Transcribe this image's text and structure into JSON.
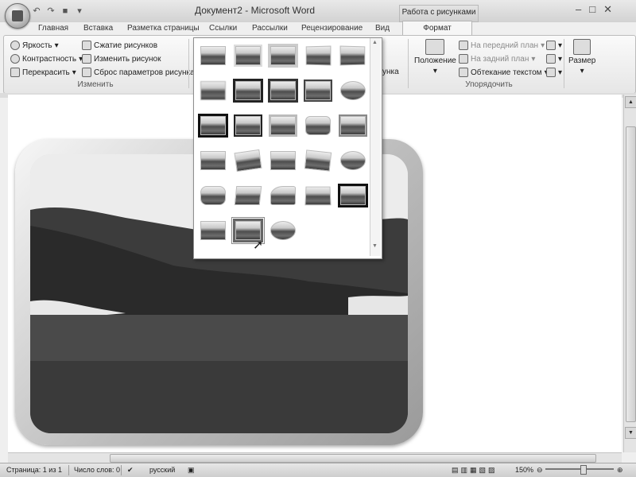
{
  "window": {
    "title": "Документ2 - Microsoft Word",
    "context_tab_group": "Работа с рисунками"
  },
  "quick_access": {
    "icons": [
      "save-icon",
      "undo-icon",
      "redo-icon",
      "customize-icon"
    ]
  },
  "tabs": [
    {
      "label": "Главная"
    },
    {
      "label": "Вставка"
    },
    {
      "label": "Разметка страницы"
    },
    {
      "label": "Ссылки"
    },
    {
      "label": "Рассылки"
    },
    {
      "label": "Рецензирование"
    },
    {
      "label": "Вид"
    },
    {
      "label": "Формат"
    }
  ],
  "ribbon": {
    "adjust": {
      "brightness": "Яркость",
      "contrast": "Контрастность",
      "recolor": "Перекрасить",
      "compress": "Сжатие рисунков",
      "change": "Изменить рисунок",
      "reset": "Сброс параметров рисунка",
      "group_label": "Изменить"
    },
    "partial_label": "унка",
    "arrange": {
      "position": "Положение",
      "bring_front": "На передний план",
      "send_back": "На задний план",
      "text_wrap": "Обтекание текстом",
      "group_label": "Упорядочить"
    },
    "size": {
      "label": "Размер"
    }
  },
  "gallery": {
    "rows": 6,
    "items_per_row": 5,
    "total_items": 28,
    "selected_index": 26
  },
  "status": {
    "page": "Страница: 1 из 1",
    "words": "Число слов: 0",
    "language": "русский",
    "zoom": "150%"
  },
  "colors": {
    "ribbon_bg": "#f0f0f0",
    "document_bg": "#ffffff",
    "frame": "#c8c8c8"
  }
}
